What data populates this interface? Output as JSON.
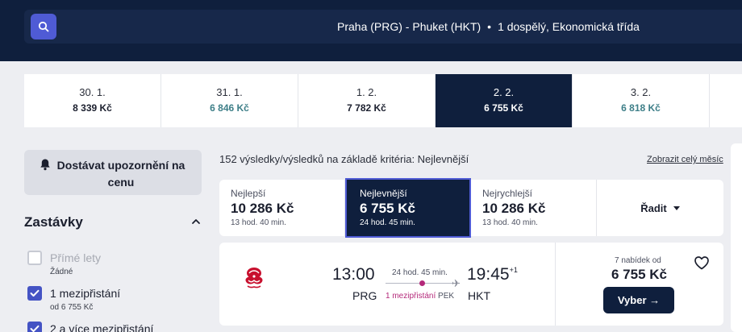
{
  "header": {
    "search_summary": "Praha (PRG) - Phuket (HKT)",
    "passengers": "1 dospělý, Ekonomická třída",
    "separator": "•",
    "icon": "search-icon"
  },
  "dates": [
    {
      "date": "30. 1.",
      "price": "8 339 Kč",
      "price_color": "#1b1f2e"
    },
    {
      "date": "31. 1.",
      "price": "6 846 Kč",
      "price_color": "#3e7f88"
    },
    {
      "date": "1. 2.",
      "price": "7 782 Kč",
      "price_color": "#1b1f2e"
    },
    {
      "date": "2. 2.",
      "price": "6 755 Kč",
      "price_color": "#ffffff",
      "selected": true
    },
    {
      "date": "3. 2.",
      "price": "6 818 Kč",
      "price_color": "#3e7f88"
    }
  ],
  "sidebar": {
    "alert_label": "Dostávat upozornění na cenu",
    "stops_title": "Zastávky",
    "filters": [
      {
        "label": "Přímé lety",
        "sub": "Žádné",
        "checked": false,
        "disabled": true
      },
      {
        "label": "1 mezipřistání",
        "sub": "od 6 755 Kč",
        "checked": true
      },
      {
        "label": "2 a více mezipřistání",
        "sub": "",
        "checked": true
      }
    ]
  },
  "results": {
    "count_text": "152 výsledky/výsledků na základě kritéria: Nejlevnější",
    "month_link": "Zobrazit celý měsíc",
    "sort_tabs": [
      {
        "name": "Nejlepší",
        "price": "10 286 Kč",
        "duration": "13 hod. 40 min."
      },
      {
        "name": "Nejlevnější",
        "price": "6 755 Kč",
        "duration": "24 hod. 45 min.",
        "active": true
      },
      {
        "name": "Nejrychlejší",
        "price": "10 286 Kč",
        "duration": "13 hod. 40 min."
      }
    ],
    "sort_label": "Řadit"
  },
  "flight": {
    "dep_time": "13:00",
    "arr_time": "19:45",
    "day_offset": "+1",
    "dep_code": "PRG",
    "arr_code": "HKT",
    "duration": "24 hod. 45 min.",
    "stops": "1 mezipřistání",
    "via": "PEK",
    "offers": "7 nabídek od",
    "price": "6 755 Kč",
    "select_label": "Vyber →",
    "accent": "#b4297a"
  },
  "colors": {
    "navy": "#0f1f3d",
    "brand": "#4f5bd5",
    "checkbox": "#4453c4"
  }
}
